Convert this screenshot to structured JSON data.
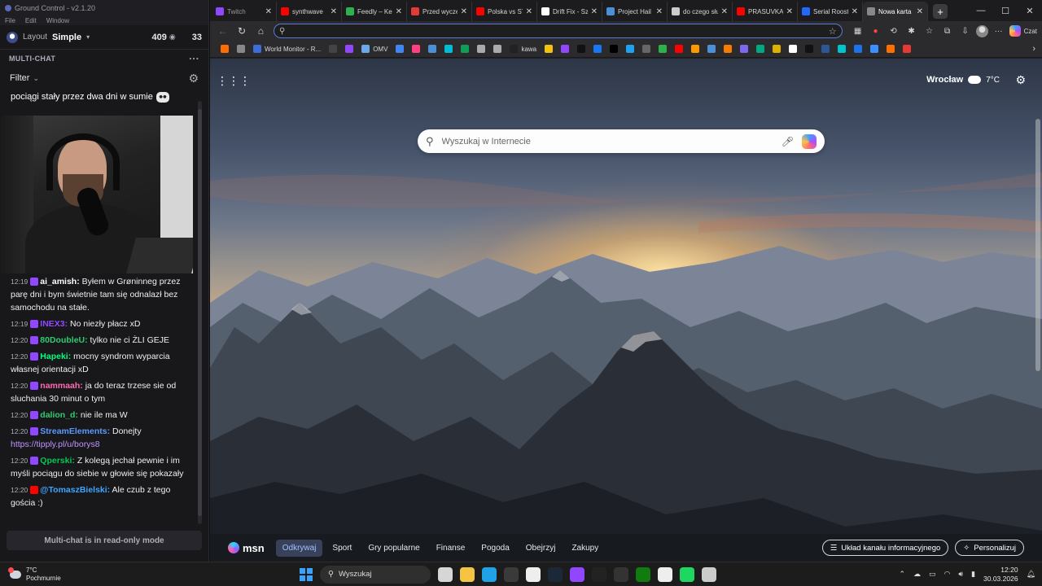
{
  "gc": {
    "window_title": "Ground Control - v2.1.20",
    "menu": [
      "File",
      "Edit",
      "Window"
    ],
    "layout_label": "Layout",
    "layout_value": "Simple",
    "viewers": "409",
    "viewers2": "33",
    "section_title": "MULTI-CHAT",
    "filter_label": "Filter",
    "top_message": "pociągi stały przez dwa dni w sumie",
    "readonly_notice": "Multi-chat is in read-only mode",
    "messages": [
      {
        "time": "12:19",
        "user": "ai_amish:",
        "user_color": "#ffffff",
        "text": "Byłem w Grøninneg przez parę dni i bym świetnie tam się odnalazł bez samochodu na stałe."
      },
      {
        "time": "12:19",
        "user": "INEX3:",
        "user_color": "#9147ff",
        "text": "No niezły płacz xD"
      },
      {
        "time": "12:20",
        "user": "80DoubleU:",
        "user_color": "#2ecc71",
        "text": "tylko nie ci ŻLI GEJE"
      },
      {
        "time": "12:20",
        "user": "Hapeki:",
        "user_color": "#00ff7f",
        "text": "mocny syndrom wyparcia własnej orientacji xD"
      },
      {
        "time": "12:20",
        "user": "nammaah:",
        "user_color": "#ff69b4",
        "text": "ja do teraz trzese sie od sluchania 30 minut o tym"
      },
      {
        "time": "12:20",
        "user": "dalion_d:",
        "user_color": "#2ecc71",
        "text": "nie ile ma W"
      },
      {
        "time": "12:20",
        "user": "StreamElements:",
        "user_color": "#5b99ff",
        "text": "Donejty",
        "link": "https://tipply.pl/u/borys8"
      },
      {
        "time": "12:20",
        "user": "Qperski:",
        "user_color": "#00c853",
        "text": "Z kolegą jechał pewnie i im myśli pociągu do siebie w głowie się pokazały"
      },
      {
        "time": "12:20",
        "user": "@TomaszBielski:",
        "user_color": "#3ea6ff",
        "text": "Ale czub z tego gościa :)"
      }
    ]
  },
  "browser": {
    "tabs": [
      {
        "title": "Twitch",
        "color": "#9147ff",
        "dim": true
      },
      {
        "title": "synthwave",
        "color": "#ff0000"
      },
      {
        "title": "Feedly – Keep",
        "color": "#2bb24c"
      },
      {
        "title": "Przed wyczek",
        "color": "#e53935"
      },
      {
        "title": "Polska vs STF",
        "color": "#ff0000"
      },
      {
        "title": "Drift Fix - Szu",
        "color": "#ffffff"
      },
      {
        "title": "Project Hail M",
        "color": "#4a90d9"
      },
      {
        "title": "do czego służ",
        "color": "#cccccc"
      },
      {
        "title": "PRASUVKA -",
        "color": "#ff0000"
      },
      {
        "title": "Serial Rooste",
        "color": "#1f69ff"
      },
      {
        "title": "Nowa karta",
        "color": "#888888",
        "active": true
      }
    ],
    "new_tab_symbol": "+",
    "address_value": "",
    "chat_label": "Czat",
    "bookmarks": [
      {
        "title": "",
        "color": "#ff6d00"
      },
      {
        "title": "",
        "color": "#888888"
      },
      {
        "title": "World Monitor - R...",
        "color": "#3c6dd8"
      },
      {
        "title": "",
        "color": "#444444"
      },
      {
        "title": "",
        "color": "#9147ff"
      },
      {
        "title": "OMV",
        "color": "#6aa8e6"
      },
      {
        "title": "",
        "color": "#4285f4"
      },
      {
        "title": "",
        "color": "#ff4081"
      },
      {
        "title": "",
        "color": "#4a90d9"
      },
      {
        "title": "",
        "color": "#00bcd4"
      },
      {
        "title": "",
        "color": "#0f9d58"
      },
      {
        "title": "",
        "color": "#aaaaaa"
      },
      {
        "title": "",
        "color": "#aaaaaa"
      },
      {
        "title": "kawa",
        "color": "#222222"
      },
      {
        "title": "",
        "color": "#f4c20d"
      },
      {
        "title": "",
        "color": "#9147ff"
      },
      {
        "title": "",
        "color": "#111111"
      },
      {
        "title": "",
        "color": "#1877f2"
      },
      {
        "title": "",
        "color": "#000000"
      },
      {
        "title": "",
        "color": "#1da1f2"
      },
      {
        "title": "",
        "color": "#666666"
      },
      {
        "title": "",
        "color": "#2bb24c"
      },
      {
        "title": "",
        "color": "#ff0000"
      },
      {
        "title": "",
        "color": "#ff9900"
      },
      {
        "title": "",
        "color": "#4a90d9"
      },
      {
        "title": "",
        "color": "#f57c00"
      },
      {
        "title": "",
        "color": "#7b68ee"
      },
      {
        "title": "",
        "color": "#00a884"
      },
      {
        "title": "",
        "color": "#e0b000"
      },
      {
        "title": "",
        "color": "#ffffff"
      },
      {
        "title": "",
        "color": "#111111"
      },
      {
        "title": "",
        "color": "#2b5797"
      },
      {
        "title": "",
        "color": "#00c4cc"
      },
      {
        "title": "",
        "color": "#1a73e8"
      },
      {
        "title": "",
        "color": "#3c8fff"
      },
      {
        "title": "",
        "color": "#ff6f00"
      },
      {
        "title": "",
        "color": "#e53935"
      }
    ],
    "weather": {
      "city": "Wrocław",
      "temp": "7°C"
    },
    "search_placeholder": "Wyszukaj w Internecie",
    "msn_logo": "msn",
    "msn_tabs": [
      "Odkrywaj",
      "Sport",
      "Gry popularne",
      "Finanse",
      "Pogoda",
      "Obejrzyj",
      "Zakupy"
    ],
    "msn_feed_layout": "Układ kanału informacyjnego",
    "msn_personalize": "Personalizuj"
  },
  "taskbar": {
    "weather_temp": "7°C",
    "weather_desc": "Pochmurnie",
    "search_label": "Wyszukaj",
    "time": "12:20",
    "date": "30.03.2026",
    "apps": [
      {
        "name": "task-view-icon",
        "color": "#d6d6d6"
      },
      {
        "name": "file-explorer-icon",
        "color": "#f4c542"
      },
      {
        "name": "edge-icon",
        "color": "#1fa2e6"
      },
      {
        "name": "obs-icon",
        "color": "#3a3a3a"
      },
      {
        "name": "store-icon",
        "color": "#eeeeee"
      },
      {
        "name": "steam-icon",
        "color": "#1b2838"
      },
      {
        "name": "twitch-icon",
        "color": "#9147ff"
      },
      {
        "name": "maps-icon",
        "color": "#222222"
      },
      {
        "name": "terminal-icon",
        "color": "#333333"
      },
      {
        "name": "xbox-icon",
        "color": "#107c10"
      },
      {
        "name": "messenger-icon",
        "color": "#eeeeee"
      },
      {
        "name": "spotify-icon",
        "color": "#1ed760"
      },
      {
        "name": "chrome-icon",
        "color": "#cccccc"
      }
    ]
  }
}
